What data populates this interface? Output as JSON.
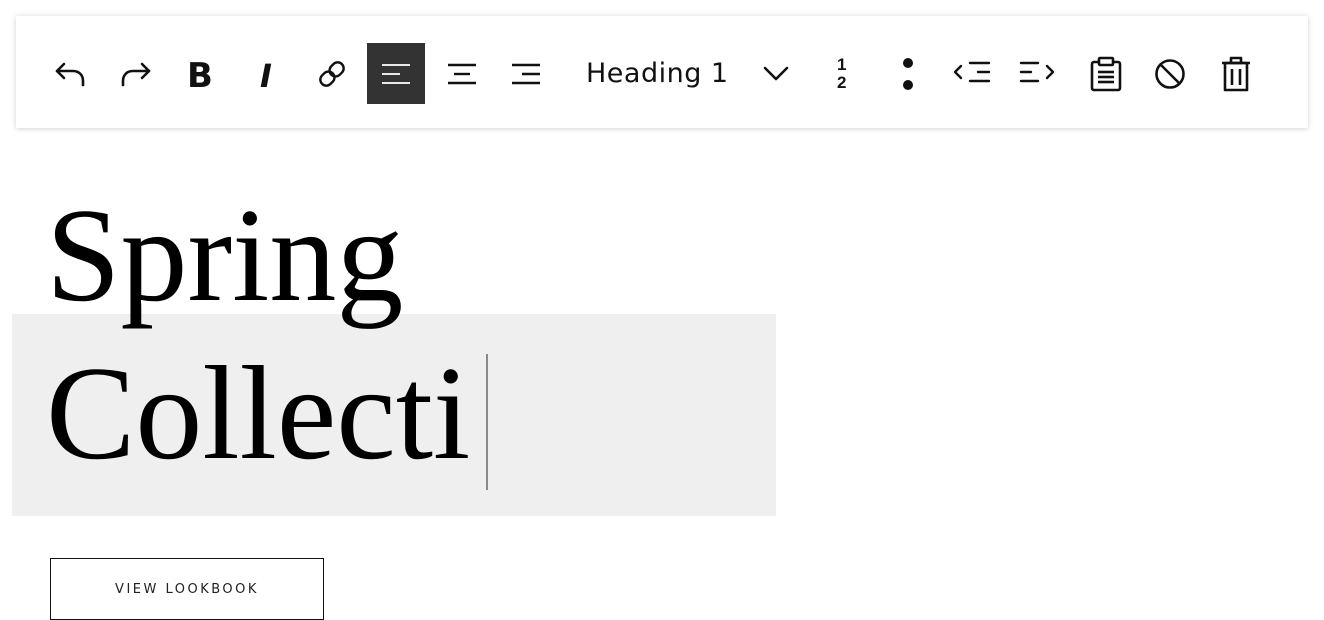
{
  "toolbar": {
    "buttons": [
      {
        "id": "undo",
        "icon": "undo-icon"
      },
      {
        "id": "redo",
        "icon": "redo-icon"
      },
      {
        "id": "bold",
        "icon": "bold-icon",
        "glyph": "B"
      },
      {
        "id": "italic",
        "icon": "italic-icon",
        "glyph": "I"
      },
      {
        "id": "link",
        "icon": "link-icon"
      },
      {
        "id": "align-left",
        "icon": "align-left-icon",
        "active": true
      },
      {
        "id": "align-center",
        "icon": "align-center-icon"
      },
      {
        "id": "align-right",
        "icon": "align-right-icon"
      },
      {
        "id": "ordered-list",
        "icon": "ordered-list-icon",
        "glyph_num": "1",
        "glyph_den": "2"
      },
      {
        "id": "unordered-list",
        "icon": "bullet-list-icon"
      },
      {
        "id": "outdent",
        "icon": "outdent-icon"
      },
      {
        "id": "indent",
        "icon": "indent-icon"
      },
      {
        "id": "paste",
        "icon": "clipboard-icon"
      },
      {
        "id": "clear-format",
        "icon": "no-format-icon"
      },
      {
        "id": "delete",
        "icon": "trash-icon"
      }
    ],
    "format_select": {
      "value": "Heading 1",
      "icon": "chevron-down-icon"
    }
  },
  "content": {
    "heading_line1": "Spring",
    "heading_line2": "Collecti",
    "button_label": "VIEW LOOKBOOK"
  },
  "colors": {
    "active_button_bg": "#333333",
    "highlight_bg": "#efefef",
    "text": "#000000"
  }
}
